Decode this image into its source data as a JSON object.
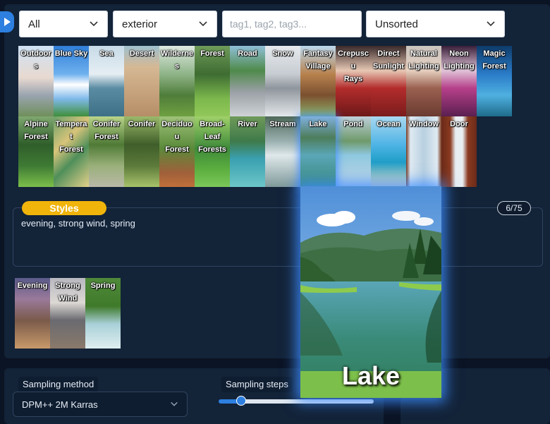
{
  "filters": {
    "category": "All",
    "subcategory": "exterior",
    "tags_placeholder": "tag1, tag2, tag3...",
    "sort": "Unsorted"
  },
  "cards_row1": [
    {
      "label": "Outdoors",
      "icon": "anime-girl-outdoors"
    },
    {
      "label": "Blue Sky",
      "icon": "blue-sky"
    },
    {
      "label": "Sea",
      "icon": "sea"
    },
    {
      "label": "Desert",
      "icon": "desert"
    },
    {
      "label": "Wildernes",
      "icon": "wilderness"
    },
    {
      "label": "Forest",
      "icon": "forest"
    },
    {
      "label": "Road",
      "icon": "road"
    },
    {
      "label": "Snow",
      "icon": "snow"
    },
    {
      "label": "Fantasy\nVillage",
      "icon": "fantasy-village"
    },
    {
      "label": "Crepuscu\nRays",
      "icon": "crepuscular-rays"
    },
    {
      "label": "Direct\nSunlight",
      "icon": "direct-sunlight"
    },
    {
      "label": "Natural\nLighting",
      "icon": "natural-lighting"
    },
    {
      "label": "Neon\nLighting",
      "icon": "neon-lighting"
    },
    {
      "label": "Magic\nForest",
      "icon": "magic-forest"
    }
  ],
  "cards_row2": [
    {
      "label": "Alpine\nForest",
      "icon": "alpine-forest"
    },
    {
      "label": "Temperat\nForest",
      "icon": "temperate-forest"
    },
    {
      "label": "Conifer\nForest",
      "icon": "conifer-forest"
    },
    {
      "label": "Conifer",
      "icon": "conifer"
    },
    {
      "label": "Deciduou\nForest",
      "icon": "deciduous-forest"
    },
    {
      "label": "Broad-\nLeaf\nForests",
      "icon": "broadleaf-forests"
    },
    {
      "label": "River",
      "icon": "river"
    },
    {
      "label": "Stream",
      "icon": "stream"
    },
    {
      "label": "Lake",
      "icon": "lake"
    },
    {
      "label": "Pond",
      "icon": "pond"
    },
    {
      "label": "Ocean",
      "icon": "ocean"
    },
    {
      "label": "Window",
      "icon": "window"
    },
    {
      "label": "Door",
      "icon": "door"
    }
  ],
  "styles": {
    "label": "Styles",
    "value": "evening, strong wind, spring",
    "counter": "6/75"
  },
  "selected_cards": [
    {
      "label": "Evening",
      "icon": "evening-village"
    },
    {
      "label": "Strong\nWind",
      "icon": "strong-wind"
    },
    {
      "label": "Spring",
      "icon": "spring-stream"
    }
  ],
  "preview": {
    "name": "Lake",
    "icon": "lake-preview"
  },
  "sampling": {
    "method_label": "Sampling method",
    "method_value": "DPM++ 2M Karras",
    "steps_label": "Sampling steps",
    "steps_fraction": 0.12
  },
  "colors": {
    "background": "#0b1424",
    "panel": "#132338",
    "accent": "#2d7fe0",
    "styles_pill": "#f0b40a",
    "glow": "#3c8cff"
  }
}
